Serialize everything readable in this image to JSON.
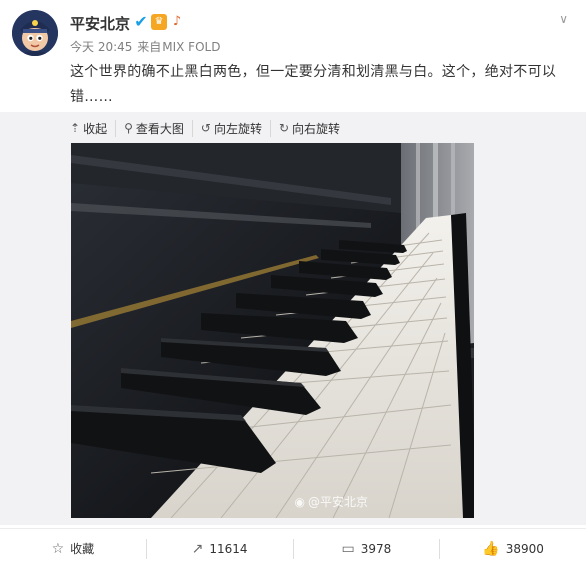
{
  "post": {
    "author": "平安北京",
    "time": "今天 20:45",
    "source_prefix": "来自",
    "source": "MIX FOLD",
    "text": "这个世界的确不止黑白两色，但一定要分清和划清黑与白。这个，绝对不可以错……",
    "badges": [
      "verified-v-icon",
      "member-crown-icon",
      "guitar-icon"
    ]
  },
  "media_toolbar": {
    "collapse": "收起",
    "view_large": "查看大图",
    "rotate_left": "向左旋转",
    "rotate_right": "向右旋转"
  },
  "photo": {
    "watermark": "@平安北京",
    "subject": "piano-keys-photo"
  },
  "actions": {
    "favorite": "收藏",
    "repost_count": "11614",
    "comment_count": "3978",
    "like_count": "38900"
  },
  "colors": {
    "accent": "#1a9fe6",
    "text": "#333333",
    "meta": "#808080",
    "media_bg": "#f2f2f5"
  }
}
